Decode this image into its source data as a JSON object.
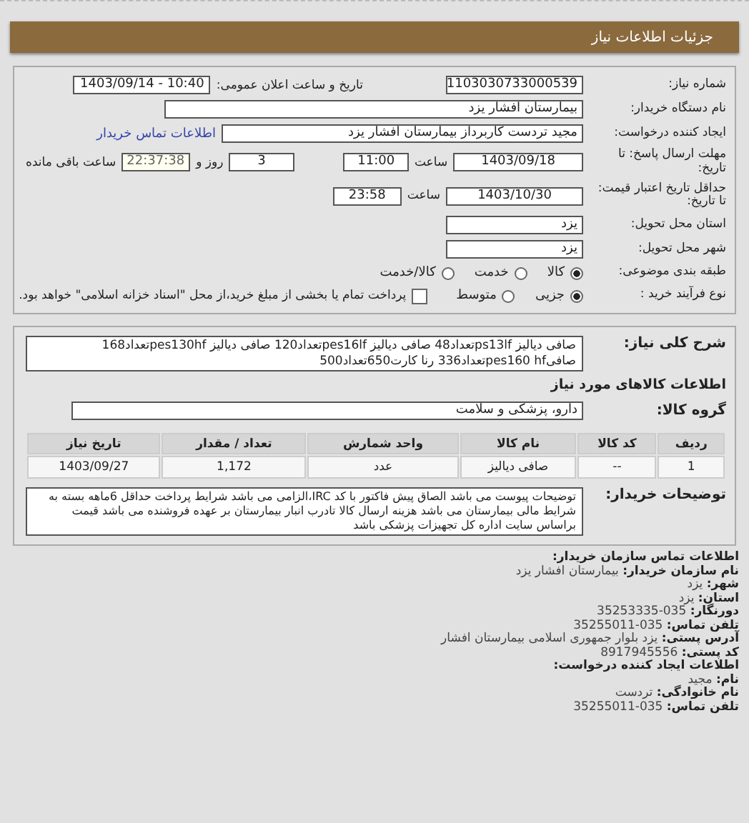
{
  "header": {
    "title": "جزئیات اطلاعات نیاز"
  },
  "details": {
    "need_number": {
      "label": "شماره نیاز:",
      "value": "1103030733000539"
    },
    "announce": {
      "label": "تاریخ و ساعت اعلان عمومی:",
      "value": "1403/09/14 - 10:40"
    },
    "buyer_org": {
      "label": "نام دستگاه خریدار:",
      "value": "بیمارستان افشار یزد"
    },
    "requester": {
      "label": "ایجاد کننده درخواست:",
      "value": "مجید تردست کاربرداز بیمارستان افشار یزد",
      "link": "اطلاعات تماس خریدار"
    },
    "deadline": {
      "label": "مهلت ارسال پاسخ: تا تاریخ:",
      "date": "1403/09/18",
      "time_label": "ساعت",
      "time": "11:00",
      "days": "3",
      "days_label": "روز و",
      "remaining": "22:37:38",
      "remaining_label": "ساعت باقی مانده"
    },
    "validity": {
      "label": "حداقل تاریخ اعتبار قیمت: تا تاریخ:",
      "date": "1403/10/30",
      "time_label": "ساعت",
      "time": "23:58"
    },
    "province": {
      "label": "استان محل تحویل:",
      "value": "یزد"
    },
    "city": {
      "label": "شهر محل تحویل:",
      "value": "یزد"
    },
    "category": {
      "label": "طبقه بندی موضوعی:",
      "options": [
        {
          "label": "کالا",
          "selected": true
        },
        {
          "label": "خدمت",
          "selected": false
        },
        {
          "label": "کالا/خدمت",
          "selected": false
        }
      ]
    },
    "process": {
      "label": "نوع فرآیند خرید :",
      "options": [
        {
          "label": "جزیی",
          "selected": true
        },
        {
          "label": "متوسط",
          "selected": false
        }
      ],
      "payment": {
        "label": "پرداخت تمام یا بخشی از مبلغ خرید،از محل \"اسناد خزانه اسلامی\" خواهد بود.",
        "checked": false
      }
    }
  },
  "summary": {
    "label": "شرح کلی نیاز:",
    "text": "صافی دیالیز ps13lfتعداد48 صافی دیالیز pes16lfتعداد120 صافی دیالیز pes130hfتعداد168 صافیpes160 hfتعداد336 رنا کارت650تعداد500"
  },
  "goods_title": "اطلاعات کالاهای مورد نیاز",
  "goods_group": {
    "label": "گروه کالا:",
    "value": "دارو، پزشکی و سلامت"
  },
  "table": {
    "columns": [
      "ردیف",
      "کد کالا",
      "نام کالا",
      "واحد شمارش",
      "تعداد / مقدار",
      "تاریخ نیاز"
    ],
    "rows": [
      {
        "cells": [
          "1",
          "--",
          "صافی دیالیز",
          "عدد",
          "1,172",
          "1403/09/27"
        ]
      }
    ]
  },
  "buyer_notes": {
    "label": "توضیحات خریدار:",
    "text": "توضیحات پیوست می باشد الصاق پیش فاکتور با کد IRC،الزامی می باشد شرایط پرداخت حداقل 6ماهه بسته به شرایط مالی بیمارستان می باشد هزینه ارسال کالا تادرب انبار بیمارستان بر عهده فروشنده می باشد قیمت براساس سایت اداره کل تجهیزات پزشکی باشد"
  },
  "contact": {
    "title": "اطلاعات تماس سازمان خریدار:",
    "lines": [
      {
        "kind": "field",
        "label": "نام سازمان خریدار:",
        "value": "بیمارستان افشار یزد"
      },
      {
        "kind": "field",
        "label": "شهر:",
        "value": "یزد"
      },
      {
        "kind": "field",
        "label": "استان:",
        "value": "یزد"
      },
      {
        "kind": "field",
        "label": "دورنگار:",
        "value": "035-35253335"
      },
      {
        "kind": "field",
        "label": "تلفن تماس:",
        "value": "035-35255011"
      },
      {
        "kind": "field",
        "label": "آدرس پستی:",
        "value": "یزد بلوار جمهوری اسلامی بیمارستان افشار"
      },
      {
        "kind": "field",
        "label": "کد پستی:",
        "value": "8917945556"
      },
      {
        "kind": "heading",
        "label": "اطلاعات ایجاد کننده درخواست:"
      },
      {
        "kind": "field",
        "label": "نام:",
        "value": "مجید"
      },
      {
        "kind": "field",
        "label": "نام خانوادگی:",
        "value": "تردست"
      },
      {
        "kind": "field",
        "label": "تلفن تماس:",
        "value": "035-35255011"
      }
    ]
  }
}
